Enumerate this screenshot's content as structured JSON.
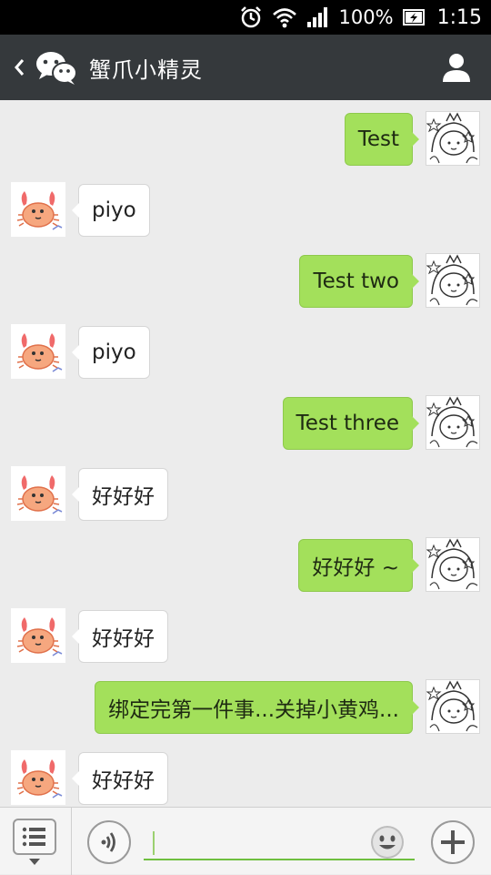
{
  "status_bar": {
    "battery_percent": "100%",
    "time": "1:15",
    "icons": [
      "alarm-icon",
      "wifi-icon",
      "signal-icon",
      "battery-charging-icon"
    ]
  },
  "header": {
    "title": "蟹爪小精灵",
    "back_icon": "chevron-left-icon",
    "app_icon": "wechat-icon",
    "profile_icon": "person-icon"
  },
  "messages": [
    {
      "side": "out",
      "text": "Test"
    },
    {
      "side": "in",
      "text": "piyo"
    },
    {
      "side": "out",
      "text": "Test two"
    },
    {
      "side": "in",
      "text": "piyo"
    },
    {
      "side": "out",
      "text": "Test three"
    },
    {
      "side": "in",
      "text": "好好好"
    },
    {
      "side": "out",
      "text": "好好好 ~"
    },
    {
      "side": "in",
      "text": "好好好"
    },
    {
      "side": "out",
      "text": "绑定完第一件事...关掉小黄鸡..."
    },
    {
      "side": "in",
      "text": "好好好"
    }
  ],
  "input_bar": {
    "text_value": "",
    "icons": [
      "menu-list-icon",
      "voice-icon",
      "emoji-icon",
      "plus-icon"
    ]
  },
  "colors": {
    "header_bg": "#35393c",
    "chat_bg": "#ececec",
    "outgoing_bubble": "#a3e05b",
    "incoming_bubble": "#ffffff",
    "input_accent": "#6fbf3f"
  }
}
